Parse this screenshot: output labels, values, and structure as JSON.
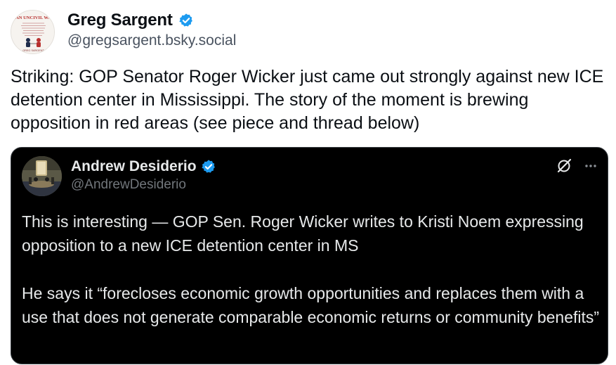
{
  "post": {
    "author": {
      "display_name": "Greg Sargent",
      "handle": "@gregsargent.bsky.social",
      "verified": true,
      "avatar": {
        "type": "book-cover",
        "cover_title": "AN UNCIVIL WA",
        "cover_author": "GREG SARGENT"
      }
    },
    "text": "Striking: GOP Senator Roger Wicker just came out strongly against new ICE detention center in Mississippi. The story of the moment is brewing opposition in red areas (see piece and thread below)"
  },
  "quoted_post": {
    "author": {
      "display_name": "Andrew Desiderio",
      "handle": "@AndrewDesiderio",
      "verified": true
    },
    "icons": {
      "grok": "grok-icon",
      "more": "more-options-icon"
    },
    "paragraphs": [
      "This is interesting — GOP Sen. Roger Wicker writes to Kristi Noem expressing opposition to a new ICE detention center in MS",
      "He says it “forecloses economic growth opportunities and replaces them with a use that does not generate comparable economic returns or community benefits”"
    ]
  },
  "colors": {
    "verified_blue": "#1d9bf0",
    "handle_gray": "#4a5360",
    "quote_bg": "#000000",
    "quote_text": "#e7e9ea",
    "quote_handle": "#71767b"
  }
}
